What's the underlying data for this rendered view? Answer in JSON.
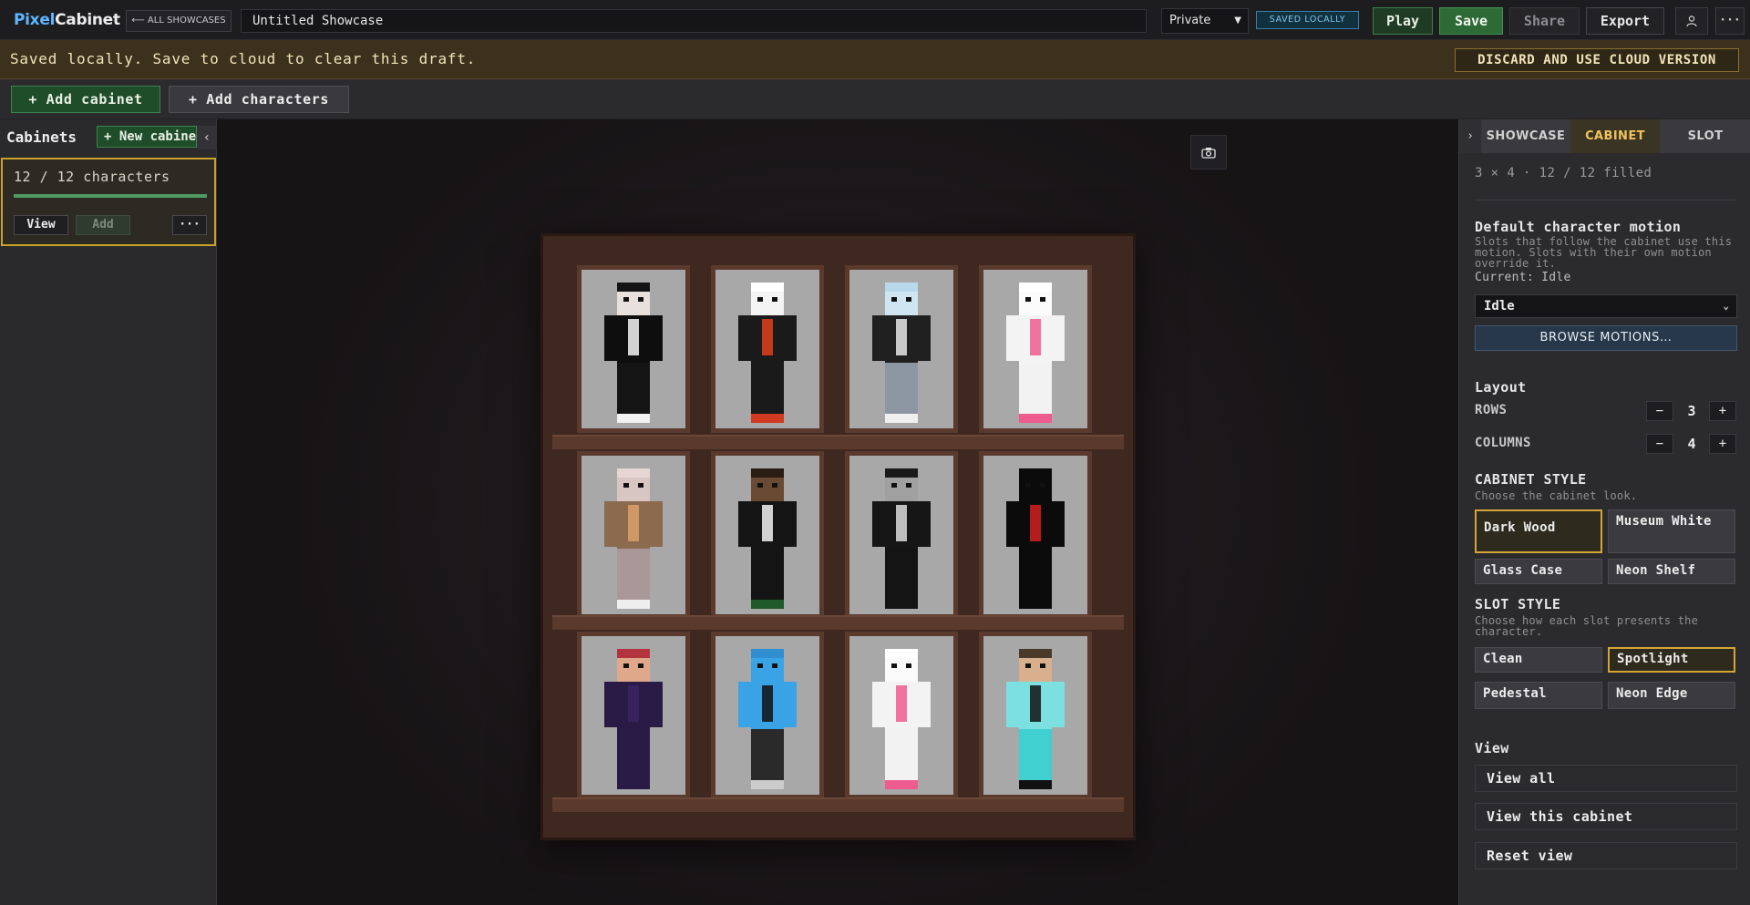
{
  "app": {
    "logo_part1": "Pixel",
    "logo_part2": "Cabinet"
  },
  "topbar": {
    "back_label": "⟵ ALL SHOWCASES",
    "title_value": "Untitled Showcase",
    "visibility_value": "Private",
    "saved_badge": "SAVED LOCALLY",
    "play_label": "Play",
    "save_label": "Save",
    "share_label": "Share",
    "export_label": "Export",
    "user_icon": "user-icon",
    "more_icon": "more-icon"
  },
  "banner": {
    "message": "Saved locally. Save to cloud to clear this draft.",
    "discard_label": "DISCARD AND USE CLOUD VERSION"
  },
  "toolbar": {
    "add_cabinet": "+ Add cabinet",
    "add_characters": "+ Add characters"
  },
  "left_panel": {
    "title": "Cabinets",
    "new_cabinet": "+ New cabinet",
    "collapse_icon": "chevron-left-icon",
    "cabinet": {
      "count_text": "12 / 12 characters",
      "fill_fraction": 1.0,
      "view_label": "View",
      "add_label": "Add",
      "more_label": "···"
    }
  },
  "viewport": {
    "camera_icon": "camera-icon",
    "cabinet_rows": 3,
    "cabinet_columns": 4
  },
  "right_panel": {
    "tabs": [
      {
        "label": "SHOWCASE",
        "active": false
      },
      {
        "label": "CABINET",
        "active": true
      },
      {
        "label": "SLOT",
        "active": false
      }
    ],
    "summary": "3 × 4 · 12 / 12 filled",
    "motion": {
      "title": "Default character motion",
      "description": "Slots that follow the cabinet use this motion. Slots with their own motion override it.",
      "current_label": "Current: Idle",
      "select_value": "Idle",
      "browse_label": "BROWSE MOTIONS…"
    },
    "layout": {
      "title": "Layout",
      "rows_label": "ROWS",
      "rows_value": "3",
      "columns_label": "COLUMNS",
      "columns_value": "4"
    },
    "cabinet_style": {
      "title": "CABINET STYLE",
      "description": "Choose the cabinet look.",
      "options": [
        "Dark Wood",
        "Museum White",
        "Glass Case",
        "Neon Shelf"
      ],
      "selected": "Dark Wood"
    },
    "slot_style": {
      "title": "SLOT STYLE",
      "description": "Choose how each slot presents the character.",
      "options": [
        "Clean",
        "Spotlight",
        "Pedestal",
        "Neon Edge"
      ],
      "selected": "Spotlight"
    },
    "view": {
      "title": "View",
      "view_all": "View all",
      "view_cabinet": "View this cabinet",
      "reset_view": "Reset view"
    }
  },
  "colors": {
    "accent_gold": "#d3a637",
    "save_green": "#2d6a36",
    "banner_bg": "#3b311d",
    "wood": "#3f2820"
  }
}
